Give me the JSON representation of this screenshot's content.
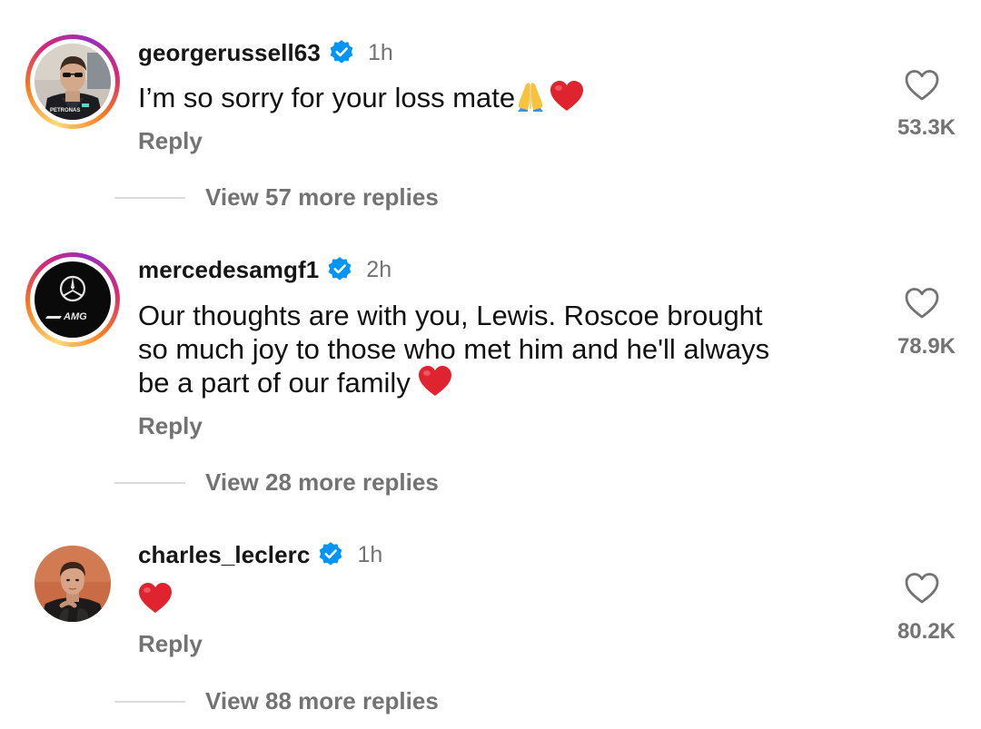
{
  "comments": [
    {
      "username": "georgerussell63",
      "time": "1h",
      "text": "I’m so sorry for your loss mate",
      "emojis": [
        "pray-emoji",
        "red-heart-emoji"
      ],
      "reply_label": "Reply",
      "likes": "53.3K",
      "view_replies": "View 57 more replies",
      "avatar": "george-russell-avatar",
      "has_story_ring": true
    },
    {
      "username": "mercedesamgf1",
      "time": "2h",
      "text_lines": [
        "Our thoughts are with you, Lewis. Roscoe brought",
        "so much joy to those who met him and he'll always",
        "be a part of our family"
      ],
      "emojis": [
        "red-heart-emoji"
      ],
      "reply_label": "Reply",
      "likes": "78.9K",
      "view_replies": "View 28 more replies",
      "avatar": "mercedes-amg-logo-avatar",
      "avatar_logo_text": "AMG",
      "has_story_ring": true
    },
    {
      "username": "charles_leclerc",
      "time": "1h",
      "emojis": [
        "red-heart-emoji"
      ],
      "reply_label": "Reply",
      "likes": "80.2K",
      "view_replies": "View 88 more replies",
      "avatar": "charles-leclerc-avatar",
      "has_story_ring": false
    }
  ],
  "colors": {
    "verified_blue": "#0095f6",
    "secondary_text": "#737373",
    "heart_red": "#e0242f"
  },
  "icons": {
    "like": "heart-outline-icon",
    "verified": "verified-badge-icon"
  }
}
